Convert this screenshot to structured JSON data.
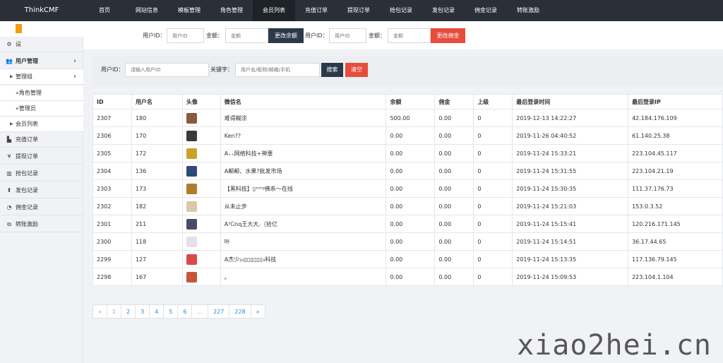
{
  "brand": "ThinkCMF",
  "top_nav": [
    {
      "label": "首页",
      "active": false
    },
    {
      "label": "网站信息",
      "active": false
    },
    {
      "label": "模板管理",
      "active": false
    },
    {
      "label": "角色管理",
      "active": false
    },
    {
      "label": "会员列表",
      "active": true
    },
    {
      "label": "充值订单",
      "active": false
    },
    {
      "label": "提现订单",
      "active": false
    },
    {
      "label": "抢包记录",
      "active": false
    },
    {
      "label": "发包记录",
      "active": false
    },
    {
      "label": "佣金记录",
      "active": false
    },
    {
      "label": "转账激励",
      "active": false
    }
  ],
  "sidebar": {
    "partial_item": "设",
    "user_manage": "用户管理",
    "manage_group": "管理组",
    "role_manage": "»角色管理",
    "admin": "»管理员",
    "member_list": "会员列表",
    "items": [
      "充值订单",
      "提现订单",
      "抢包记录",
      "发包记录",
      "佣金记录",
      "转账激励"
    ],
    "icons": [
      "chart-area-icon",
      "yen-icon",
      "bar-chart-icon",
      "upload-icon",
      "pie-chart-icon",
      "transfer-icon"
    ],
    "glyphs": [
      "▙",
      "¥",
      "▥",
      "⬆",
      "◔",
      "⧉"
    ]
  },
  "top_form": {
    "uid_label": "用户ID：",
    "uid_placeholder": "用户ID",
    "amount_label": "金额：",
    "amount_placeholder": "金额",
    "balance_btn": "更改余额",
    "uid_label2": "用户ID：",
    "uid_placeholder2": "用户ID",
    "amount_label2": "金额：",
    "amount_placeholder2": "金额",
    "commission_btn": "更改佣金"
  },
  "search": {
    "uid_label": "用户ID：",
    "uid_placeholder": "请输入用户ID",
    "keyword_label": "关键字：",
    "keyword_placeholder": "用户名/昵称/邮箱/手机",
    "search_btn": "搜索",
    "clear_btn": "清空"
  },
  "table": {
    "headers": [
      "ID",
      "用户名",
      "头像",
      "微信名",
      "余额",
      "佣金",
      "上级",
      "最后登录时间",
      "最后登录IP"
    ],
    "rows": [
      {
        "id": "2307",
        "username": "180",
        "wechat": "难得糊涂",
        "balance": "500.00",
        "commission": "0.00",
        "parent": "0",
        "login_time": "2019-12-13 14:22:27",
        "login_ip": "42.184.176.109",
        "avatar_color": "#8a5a3a"
      },
      {
        "id": "2306",
        "username": "170",
        "wechat": "Ken??",
        "balance": "0.00",
        "commission": "0.00",
        "parent": "0",
        "login_time": "2019-11-26 04:40:52",
        "login_ip": "61.140.25.38",
        "avatar_color": "#3a3a3a"
      },
      {
        "id": "2305",
        "username": "172",
        "wechat": "A₊₊网络科技+神噩",
        "balance": "0.00",
        "commission": "0.00",
        "parent": "0",
        "login_time": "2019-11-24 15:33:21",
        "login_ip": "223.104.45.117",
        "avatar_color": "#c9a227"
      },
      {
        "id": "2304",
        "username": "136",
        "wechat": "A颠颠、水果?批发市场",
        "balance": "0.00",
        "commission": "0.00",
        "parent": "0",
        "login_time": "2019-11-24 15:31:55",
        "login_ip": "223.104.21.19",
        "avatar_color": "#2d4a7a"
      },
      {
        "id": "2303",
        "username": "173",
        "wechat": "【黑科技】▯ᶻᵒⁿᵍ佛系～在线",
        "balance": "0.00",
        "commission": "0.00",
        "parent": "0",
        "login_time": "2019-11-24 15:30:35",
        "login_ip": "111.37.176.73",
        "avatar_color": "#b07d2c"
      },
      {
        "id": "2302",
        "username": "182",
        "wechat": "从未止步",
        "balance": "0.00",
        "commission": "0.00",
        "parent": "0",
        "login_time": "2019-11-24 15:21:03",
        "login_ip": "153.0.3.52",
        "avatar_color": "#d8c9a8"
      },
      {
        "id": "2301",
        "username": "211",
        "wechat": "A³Ꮯnq王大大꜀（拾亿",
        "balance": "0.00",
        "commission": "0.00",
        "parent": "0",
        "login_time": "2019-11-24 15:15:41",
        "login_ip": "120.216.171.145",
        "avatar_color": "#4a4a6a"
      },
      {
        "id": "2300",
        "username": "118",
        "wechat": "叶",
        "balance": "0.00",
        "commission": "0.00",
        "parent": "0",
        "login_time": "2019-11-24 15:14:51",
        "login_ip": "36.17.44.65",
        "avatar_color": "#e8e0e8"
      },
      {
        "id": "2299",
        "username": "127",
        "wechat": "A杰少₂₂▯▯▯▯▯▯₉科技",
        "balance": "0.00",
        "commission": "0.00",
        "parent": "0",
        "login_time": "2019-11-24 15:13:35",
        "login_ip": "117.136.79.145",
        "avatar_color": "#d94a4a"
      },
      {
        "id": "2298",
        "username": "167",
        "wechat": "。",
        "balance": "0.00",
        "commission": "0.00",
        "parent": "0",
        "login_time": "2019-11-24 15:09:53",
        "login_ip": "223.104.1.104",
        "avatar_color": "#c8553a"
      }
    ]
  },
  "pagination": [
    "«",
    "1",
    "2",
    "3",
    "4",
    "5",
    "6",
    "...",
    "227",
    "228",
    "»"
  ],
  "watermark": "xiao2hei.cn"
}
